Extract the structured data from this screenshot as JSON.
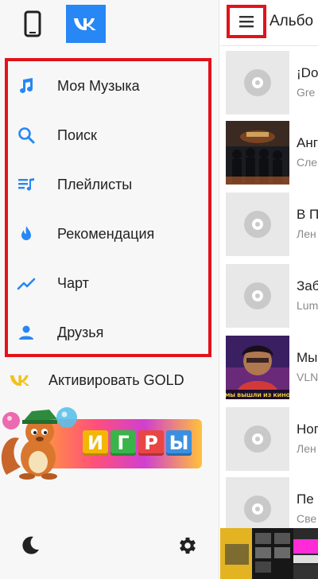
{
  "drawer": {
    "top": {
      "phone_icon": "phone-icon",
      "vk_icon": "vk-logo-icon",
      "vk_color": "#2787f5"
    },
    "menu": [
      {
        "name": "my-music",
        "label": "Моя Музыка",
        "icon": "music-note-icon"
      },
      {
        "name": "search",
        "label": "Поиск",
        "icon": "search-icon"
      },
      {
        "name": "playlists",
        "label": "Плейлисты",
        "icon": "playlist-icon"
      },
      {
        "name": "recommendations",
        "label": "Рекомендация",
        "icon": "flame-icon"
      },
      {
        "name": "chart",
        "label": "Чарт",
        "icon": "trend-icon"
      },
      {
        "name": "friends",
        "label": "Друзья",
        "icon": "person-icon"
      }
    ],
    "gold": {
      "label": "Активировать GOLD",
      "icon": "vk-gold-icon"
    },
    "games": {
      "letters": [
        "И",
        "Г",
        "Р",
        "Ы"
      ],
      "tile_colors": [
        "#f2b705",
        "#38b449",
        "#e84545",
        "#3b8fe0"
      ]
    },
    "bottom": {
      "night_icon": "moon-icon",
      "settings_icon": "gear-icon"
    }
  },
  "pane": {
    "title": "Альбо",
    "albums": [
      {
        "title": "¡Do",
        "artist": "Gre",
        "cover": "placeholder"
      },
      {
        "title": "Анг",
        "artist": "Сле",
        "cover": "art-soldiers"
      },
      {
        "title": "В П",
        "artist": "Лен",
        "cover": "placeholder"
      },
      {
        "title": "Заб",
        "artist": "Lum",
        "cover": "placeholder"
      },
      {
        "title": "Мы",
        "artist": "VLN",
        "cover": "art-portrait",
        "cover_text": "МЫ ВЫШЛИ ИЗ КИНО"
      },
      {
        "title": "Ног",
        "artist": "Лен",
        "cover": "placeholder"
      },
      {
        "title": "Пе",
        "artist": "Све",
        "cover": "placeholder"
      }
    ]
  },
  "colors": {
    "accent": "#2787f5",
    "highlight": "#e3121b"
  }
}
